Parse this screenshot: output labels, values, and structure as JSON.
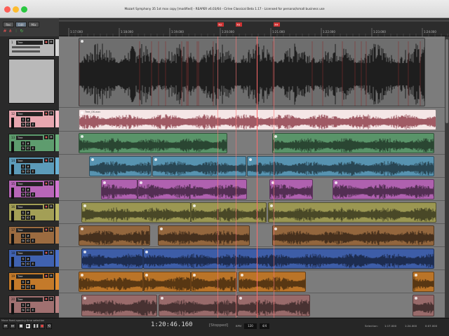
{
  "window": {
    "title": "Mozart Symphony 35 1st mov copy [modified] - REAPER v6.03/64 - Cirlee Classical Beta 1.17 - Licensed for personal/small business use"
  },
  "toolbar": {
    "tabs": [
      "Rec",
      "Edit",
      "Mix"
    ]
  },
  "ruler": {
    "ticks": [
      "1:17.000",
      "1:18.000",
      "1:19.000",
      "1:20.000",
      "1:21.000",
      "1:22.000",
      "1:23.000",
      "1:24.000"
    ],
    "markers": [
      "R2",
      "R3",
      "R4"
    ]
  },
  "tracks": [
    {
      "num": "1",
      "name": "Tree",
      "color": "#b9b9b9"
    },
    {
      "num": "12",
      "name": "Tree",
      "color": "#e8a7b0"
    },
    {
      "num": "13",
      "name": "Tree",
      "color": "#5e9c6e"
    },
    {
      "num": "14",
      "name": "Tree",
      "color": "#5c9bb9"
    },
    {
      "num": "15",
      "name": "Tree",
      "color": "#b866b8"
    },
    {
      "num": "16",
      "name": "Tree",
      "color": "#a39f56"
    },
    {
      "num": "17",
      "name": "Tree",
      "color": "#9b6b40"
    },
    {
      "num": "18",
      "name": "Tree",
      "color": "#4062b0"
    },
    {
      "num": "19",
      "name": "Tree",
      "color": "#c47a2a"
    },
    {
      "num": "20",
      "name": "Tree",
      "color": "#a07070"
    }
  ],
  "item_label": "Tree_06.wav",
  "transport": {
    "status_hint": "Move fixed-spacing time selection",
    "time": "1:20:46.160",
    "state": "[Stopped]",
    "bpm_label": "BPM",
    "bpm": "120",
    "rate": "4/4",
    "selection_label": "Selection:",
    "sel_start": "1:17.000",
    "sel_end": "1:24.000",
    "sel_len": "0:07.000"
  },
  "colors": {
    "background": "#7c7c7c",
    "cursor": "#ff6a6a"
  }
}
